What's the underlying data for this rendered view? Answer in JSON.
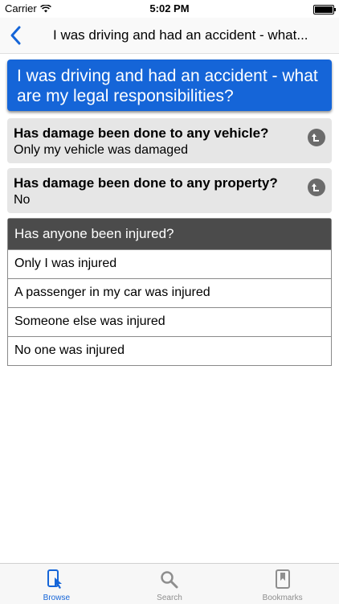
{
  "status": {
    "carrier": "Carrier",
    "time": "5:02 PM"
  },
  "nav": {
    "title": "I was driving and had an accident - what..."
  },
  "question_title": "I was driving and had an accident - what are my legal responsibilities?",
  "answered": [
    {
      "question": "Has damage been done to any vehicle?",
      "answer": "Only my vehicle was damaged"
    },
    {
      "question": "Has damage been done to any property?",
      "answer": "No"
    }
  ],
  "current": {
    "question": "Has anyone been injured?",
    "options": [
      "Only I was injured",
      "A passenger in my car was injured",
      "Someone else was injured",
      "No one was injured"
    ]
  },
  "tabs": [
    {
      "label": "Browse",
      "icon": "browse-icon",
      "active": true
    },
    {
      "label": "Search",
      "icon": "search-icon",
      "active": false
    },
    {
      "label": "Bookmarks",
      "icon": "bookmark-icon",
      "active": false
    }
  ],
  "colors": {
    "accent": "#1565d8",
    "header_dark": "#4b4b4b",
    "answered_bg": "#e6e6e6"
  }
}
